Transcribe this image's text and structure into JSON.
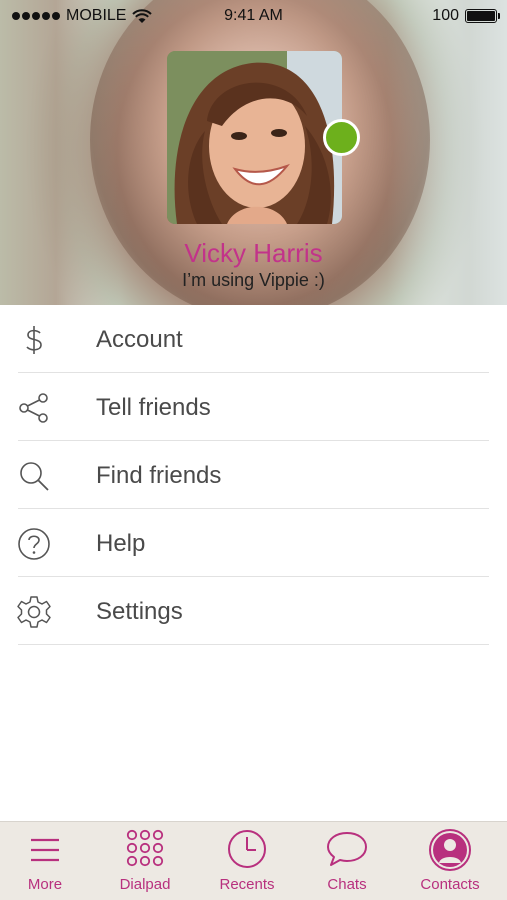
{
  "status_bar": {
    "carrier": "MOBILE",
    "time": "9:41 AM",
    "battery": "100"
  },
  "profile": {
    "name": "Vicky Harris",
    "status": "I’m using Vippie :)",
    "presence": "online"
  },
  "menu": {
    "items": [
      {
        "label": "Account",
        "icon": "dollar-icon"
      },
      {
        "label": "Tell friends",
        "icon": "share-icon"
      },
      {
        "label": "Find friends",
        "icon": "search-icon"
      },
      {
        "label": "Help",
        "icon": "help-icon"
      },
      {
        "label": "Settings",
        "icon": "gear-icon"
      }
    ]
  },
  "tabs": [
    {
      "label": "More",
      "icon": "hamburger-icon"
    },
    {
      "label": "Dialpad",
      "icon": "dialpad-icon"
    },
    {
      "label": "Recents",
      "icon": "clock-icon"
    },
    {
      "label": "Chats",
      "icon": "chat-bubble-icon"
    },
    {
      "label": "Contacts",
      "icon": "contact-icon"
    }
  ],
  "colors": {
    "accent": "#b8307e",
    "name": "#c2338a",
    "online": "#6db01c",
    "tabbar": "#ede9e3"
  }
}
